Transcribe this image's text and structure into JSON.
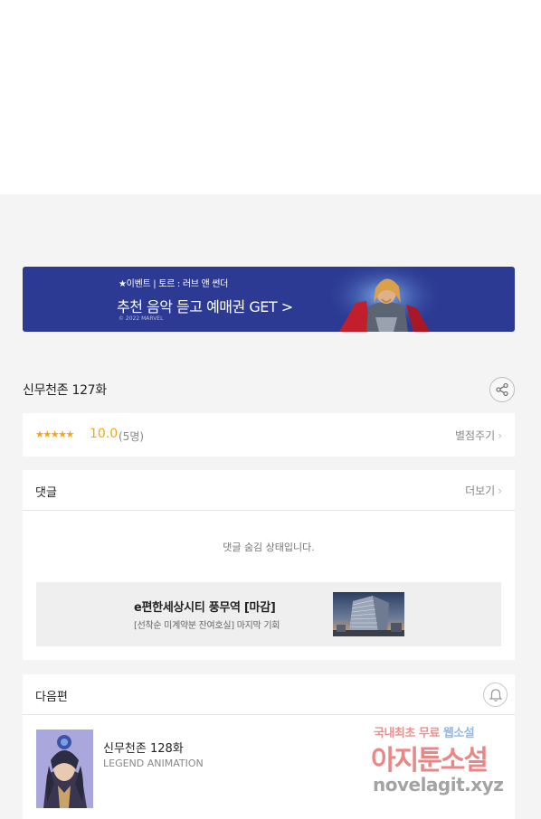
{
  "banner": {
    "small_text": "★이벤트 | 토르 : 러브 앤 썬더",
    "main_text": "추천 음악 듣고 예매권 GET >",
    "copyright": "© 2022 MARVEL"
  },
  "episode": {
    "title": "신무천존 127화"
  },
  "rating": {
    "stars": "★★★★★",
    "score": "10.0",
    "count": "(5명)",
    "rate_label": "별점주기"
  },
  "comments": {
    "title": "댓글",
    "more_label": "더보기",
    "hidden_message": "댓글 숨김 상태입니다."
  },
  "ad": {
    "title": "e편한세상시티 풍무역 [마감]",
    "subtitle": "[선착순 미계약분 잔여호실] 마지막 기회"
  },
  "next": {
    "section_title": "다음편",
    "episode_title": "신무천존 128화",
    "studio": "LEGEND ANIMATION"
  },
  "watermark": {
    "line1_a": "국내최초 무료",
    "line1_b": "웹소설",
    "main": "아지툰소설",
    "url": "novelagit.xyz"
  },
  "icons": {
    "share": "share-icon",
    "bell": "bell-icon",
    "chevron": "chevron-right-icon"
  },
  "colors": {
    "banner_bg": "#2c3a93",
    "rating_accent": "#f2a51a",
    "page_bg": "#f4f4f4"
  }
}
